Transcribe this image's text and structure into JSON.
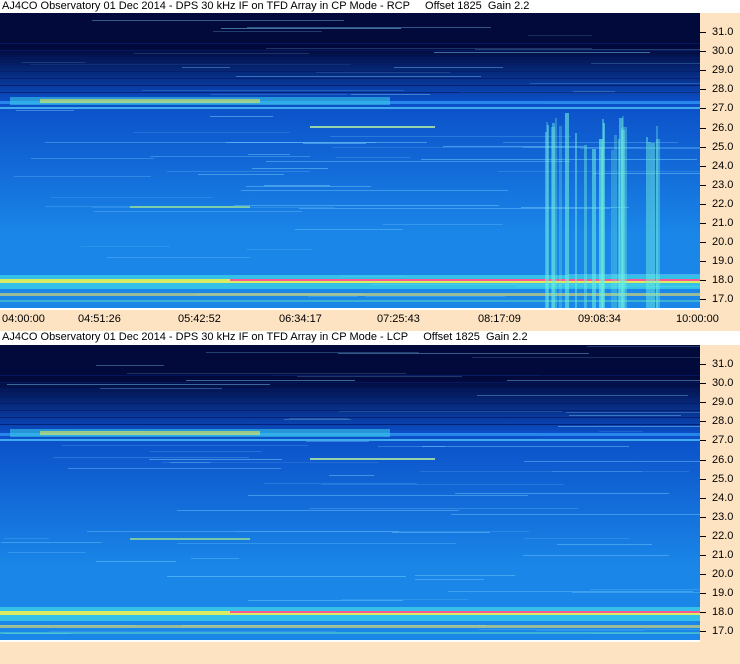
{
  "panels": [
    {
      "title": "AJ4CO Observatory 01 Dec 2014 - DPS 30 kHz IF on TFD Array in CP Mode - RCP     Offset 1825  Gain 2.2",
      "polarization": "RCP",
      "freq_labels": [
        "31.0",
        "30.0",
        "29.0",
        "28.0",
        "27.0",
        "26.0",
        "25.0",
        "24.0",
        "23.0",
        "22.0",
        "21.0",
        "20.0",
        "19.0",
        "18.0",
        "17.0"
      ],
      "time_labels": [
        "04:00:00",
        "04:51:26",
        "05:42:52",
        "06:34:17",
        "07:25:43",
        "08:17:09",
        "09:08:34",
        "10:00:00"
      ]
    },
    {
      "title": "AJ4CO Observatory 01 Dec 2014 - DPS 30 kHz IF on TFD Array in CP Mode - LCP     Offset 1825  Gain 2.2",
      "polarization": "LCP",
      "freq_labels": [
        "31.0",
        "30.0",
        "29.0",
        "28.0",
        "27.0",
        "26.0",
        "25.0",
        "24.0",
        "23.0",
        "22.0",
        "21.0",
        "20.0",
        "19.0",
        "18.0",
        "17.0"
      ],
      "time_labels": []
    }
  ],
  "colors": {
    "background_deep": "#020a3c",
    "background_mid": "#0b4fc8",
    "background_low": "#1a86e8",
    "axis_bg": "#fde3c2",
    "band_hot": "#ff40a0",
    "band_yellow": "#f6f24a",
    "band_cyan": "#48e8e8"
  }
}
